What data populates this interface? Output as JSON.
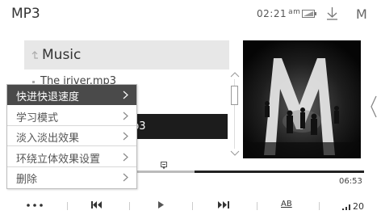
{
  "app": {
    "title": "MP3"
  },
  "status_bar": {
    "time": "02:21",
    "ampm": "am",
    "mode": "M",
    "icons": [
      "battery-icon",
      "download-icon"
    ]
  },
  "list": {
    "header": "Music",
    "items": [
      {
        "label": "The iriver.mp3"
      },
      {
        "label": "p3"
      }
    ]
  },
  "context_menu": {
    "items": [
      {
        "label": "快进快退速度",
        "active": true
      },
      {
        "label": "学习模式"
      },
      {
        "label": "淡入淡出效果"
      },
      {
        "label": "环绕立体效果设置"
      },
      {
        "label": "删除"
      }
    ]
  },
  "player": {
    "total_time": "06:53",
    "progress_fraction": 0.26
  },
  "controls": {
    "items": [
      "more-icon",
      "previous-icon",
      "play-icon",
      "next-icon",
      "ab-repeat",
      "volume-icon"
    ],
    "ab_label": "AB",
    "volume": "20"
  },
  "colors": {
    "menu_active_bg": "#4a4a4a",
    "highlight_row_bg": "#1c1c1c",
    "header_bg": "#e7e7e7"
  }
}
